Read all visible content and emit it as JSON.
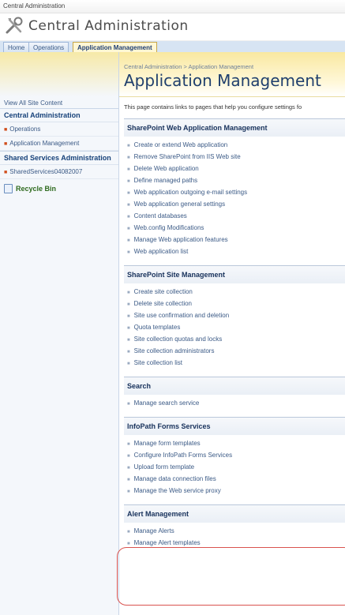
{
  "topbar": {
    "text": "Central Administration"
  },
  "header": {
    "site_title": "Central Administration"
  },
  "tabs": [
    {
      "label": "Home"
    },
    {
      "label": "Operations"
    },
    {
      "label": "Application Management"
    }
  ],
  "leftnav": {
    "view_all": "View All Site Content",
    "central_admin_heading": "Central Administration",
    "central_items": [
      {
        "label": "Operations"
      },
      {
        "label": "Application Management"
      }
    ],
    "shared_heading": "Shared Services Administration",
    "shared_items": [
      {
        "label": "SharedServices04082007"
      }
    ],
    "recycle_bin": "Recycle Bin"
  },
  "main": {
    "breadcrumb": "Central Administration > Application Management",
    "title": "Application Management",
    "intro": "This page contains links to pages that help you configure settings fo",
    "groups": [
      {
        "heading": "SharePoint Web Application Management",
        "links": [
          "Create or extend Web application",
          "Remove SharePoint from IIS Web site",
          "Delete Web application",
          "Define managed paths",
          "Web application outgoing e-mail settings",
          "Web application general settings",
          "Content databases",
          "Web.config Modifications",
          "Manage Web application features",
          "Web application list"
        ]
      },
      {
        "heading": "SharePoint Site Management",
        "links": [
          "Create site collection",
          "Delete site collection",
          "Site use confirmation and deletion",
          "Quota templates",
          "Site collection quotas and locks",
          "Site collection administrators",
          "Site collection list"
        ]
      },
      {
        "heading": "Search",
        "links": [
          "Manage search service"
        ]
      },
      {
        "heading": "InfoPath Forms Services",
        "links": [
          "Manage form templates",
          "Configure InfoPath Forms Services",
          "Upload form template",
          "Manage data connection files",
          "Manage the Web service proxy"
        ]
      },
      {
        "heading": "Alert Management",
        "links": [
          "Manage Alerts",
          "Manage Alert templates"
        ]
      }
    ]
  },
  "colors": {
    "accent_tab": "#fff7d4",
    "link": "#3b5a86",
    "heading": "#17315b",
    "highlight": "#d9534f"
  }
}
